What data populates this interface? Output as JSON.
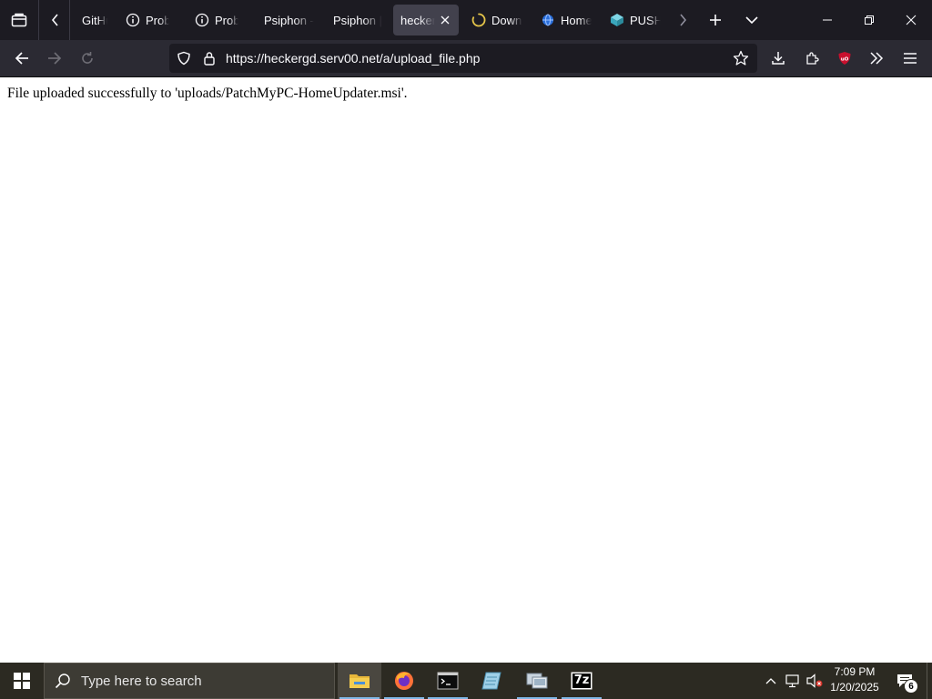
{
  "browser": {
    "tabs": [
      {
        "title": "GitHub",
        "favicon": "github-icon"
      },
      {
        "title": "Problem loading page",
        "favicon": "info-icon"
      },
      {
        "title": "Problem loading page",
        "favicon": "info-icon"
      },
      {
        "title": "Psiphon - ",
        "favicon": "none"
      },
      {
        "title": "Psiphon | ",
        "favicon": "none"
      },
      {
        "title": "heckergd",
        "favicon": "none",
        "selected": true
      },
      {
        "title": "Downloading",
        "favicon": "loading-icon"
      },
      {
        "title": "Home",
        "favicon": "blue-globe-icon"
      },
      {
        "title": "PUSH",
        "favicon": "teal-cube-icon"
      }
    ],
    "url": "https://heckergd.serv00.net/a/upload_file.php"
  },
  "page": {
    "message": "File uploaded successfully to 'uploads/PatchMyPC-HomeUpdater.msi'."
  },
  "taskbar": {
    "search_placeholder": "Type here to search",
    "apps": [
      "file-explorer",
      "firefox",
      "terminal",
      "notepad",
      "system-app",
      "7zip"
    ],
    "sevenzip_label": "7z",
    "clock_time": "7:09 PM",
    "clock_date": "1/20/2025",
    "notification_count": "6"
  },
  "colors": {
    "tabstrip_bg": "#1c1b22",
    "navbar_bg": "#2b2a33",
    "selected_tab_bg": "#42414d",
    "taskbar_bg": "#2c2a22",
    "ublock_red": "#c8102e"
  }
}
